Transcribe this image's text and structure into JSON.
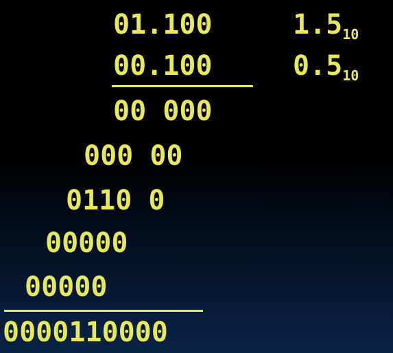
{
  "multiplicand": "01.100",
  "multiplier": "00.100",
  "multiplicand_decimal": {
    "value": "1.5",
    "base": "10"
  },
  "multiplier_decimal": {
    "value": "0.5",
    "base": "10"
  },
  "partial_products": [
    "00 000",
    "000 00",
    "0110 0",
    "00000",
    "00000"
  ],
  "result": "0000110000"
}
